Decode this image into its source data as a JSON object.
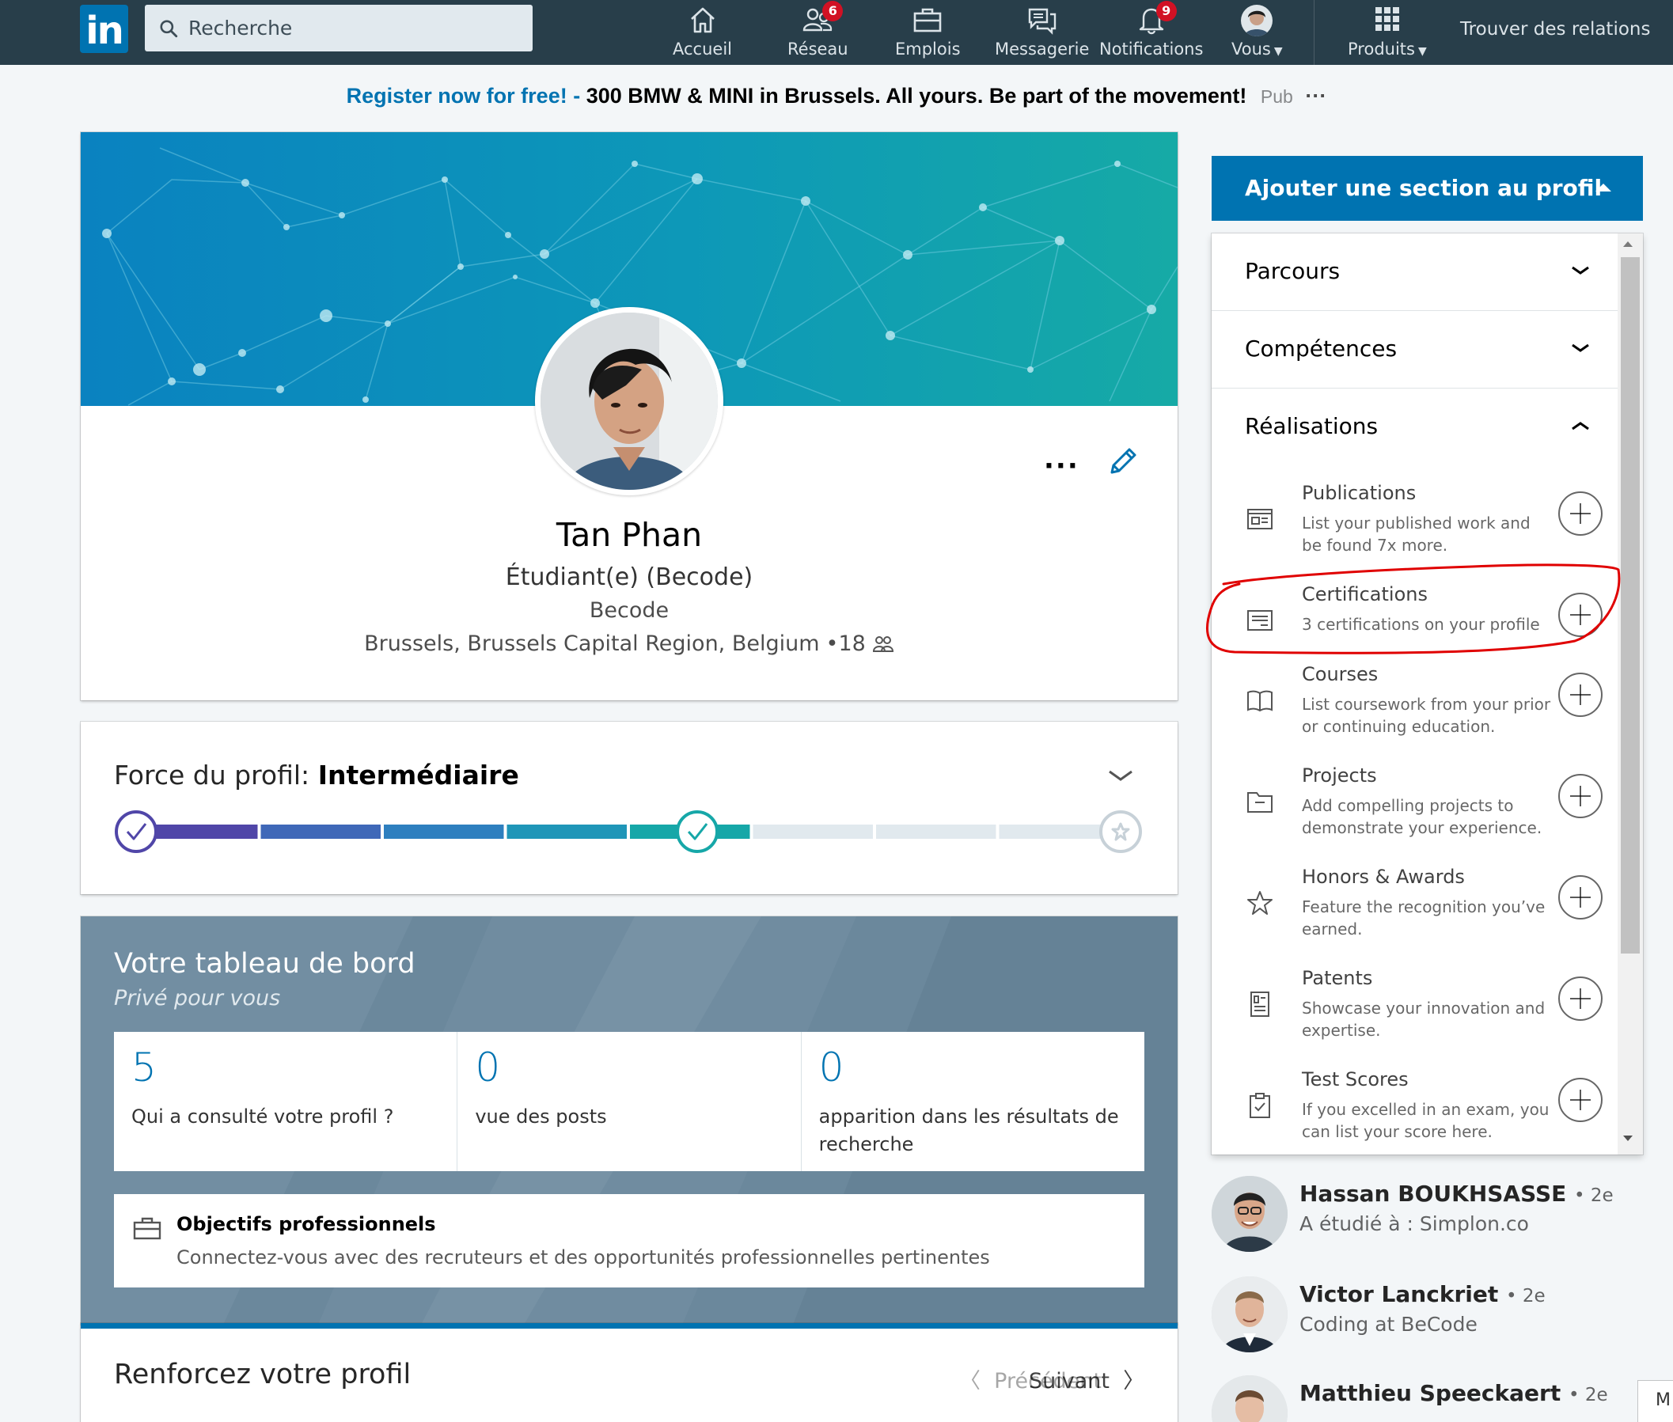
{
  "nav": {
    "logo_text": "in",
    "search_placeholder": "Recherche",
    "items": [
      {
        "label": "Accueil",
        "icon": "home-icon"
      },
      {
        "label": "Réseau",
        "icon": "network-icon",
        "badge": "6"
      },
      {
        "label": "Emplois",
        "icon": "briefcase-icon"
      },
      {
        "label": "Messagerie",
        "icon": "messaging-icon"
      },
      {
        "label": "Notifications",
        "icon": "bell-icon",
        "badge": "9"
      },
      {
        "label": "Vous",
        "icon": "avatar"
      },
      {
        "label": "Produits",
        "icon": "grid-icon"
      }
    ],
    "find_connections": "Trouver des relations"
  },
  "ad": {
    "link_text": "Register now for free! -",
    "body_text": "300 BMW & MINI in Brussels. All yours. Be part of the movement!",
    "pub_label": "Pub",
    "more_label": "···"
  },
  "profile": {
    "name": "Tan Phan",
    "headline": "Étudiant(e) (Becode)",
    "company": "Becode",
    "location": "Brussels, Brussels Capital Region, Belgium",
    "connections": "•18",
    "more_label": "···"
  },
  "strength": {
    "label": "Force du profil:",
    "level": "Intermédiaire",
    "progress_fraction": 0.57
  },
  "dashboard": {
    "title": "Votre tableau de bord",
    "subtitle": "Privé pour vous",
    "stats": [
      {
        "value": "5",
        "label": "Qui a consulté votre profil ?"
      },
      {
        "value": "0",
        "label": "vue des posts"
      },
      {
        "value": "0",
        "label": "apparition dans les résultats de recherche"
      }
    ],
    "goals": {
      "title": "Objectifs professionnels",
      "description": "Connectez-vous avec des recruteurs et des opportunités professionnelles pertinentes"
    }
  },
  "renforcez": {
    "title": "Renforcez votre profil",
    "prev": "Précédent",
    "next": "Suivant"
  },
  "add_section": {
    "button_label": "Ajouter une section au profil",
    "accordions": [
      {
        "label": "Parcours",
        "expanded": false
      },
      {
        "label": "Compétences",
        "expanded": false
      },
      {
        "label": "Réalisations",
        "expanded": true
      }
    ],
    "achievements": [
      {
        "title": "Publications",
        "description": "List your published work and be found 7x more.",
        "icon": "publication-icon"
      },
      {
        "title": "Certifications",
        "description": "3 certifications on your profile",
        "icon": "certificate-icon"
      },
      {
        "title": "Courses",
        "description": "List coursework from your prior or continuing education.",
        "icon": "book-icon"
      },
      {
        "title": "Projects",
        "description": "Add compelling projects to demonstrate your experience.",
        "icon": "folder-icon"
      },
      {
        "title": "Honors & Awards",
        "description": "Feature the recognition you’ve earned.",
        "icon": "star-icon"
      },
      {
        "title": "Patents",
        "description": "Showcase your innovation and expertise.",
        "icon": "patent-icon"
      },
      {
        "title": "Test Scores",
        "description": "If you excelled in an exam, you can list your score here.",
        "icon": "clipboard-icon"
      }
    ]
  },
  "people": [
    {
      "name": "Hassan BOUKHSASSE",
      "degree": "• 2e",
      "headline": "A étudié à : Simplon.co"
    },
    {
      "name": "Victor Lanckriet",
      "degree": "• 2e",
      "headline": "Coding at BeCode"
    },
    {
      "name": "Matthieu Speeckaert",
      "degree": "• 2e",
      "headline": ""
    }
  ],
  "messaging_tab": "M",
  "colors": {
    "nav_bg": "#283e4a",
    "brand_blue": "#0073b1",
    "annotation_red": "#e00000"
  }
}
